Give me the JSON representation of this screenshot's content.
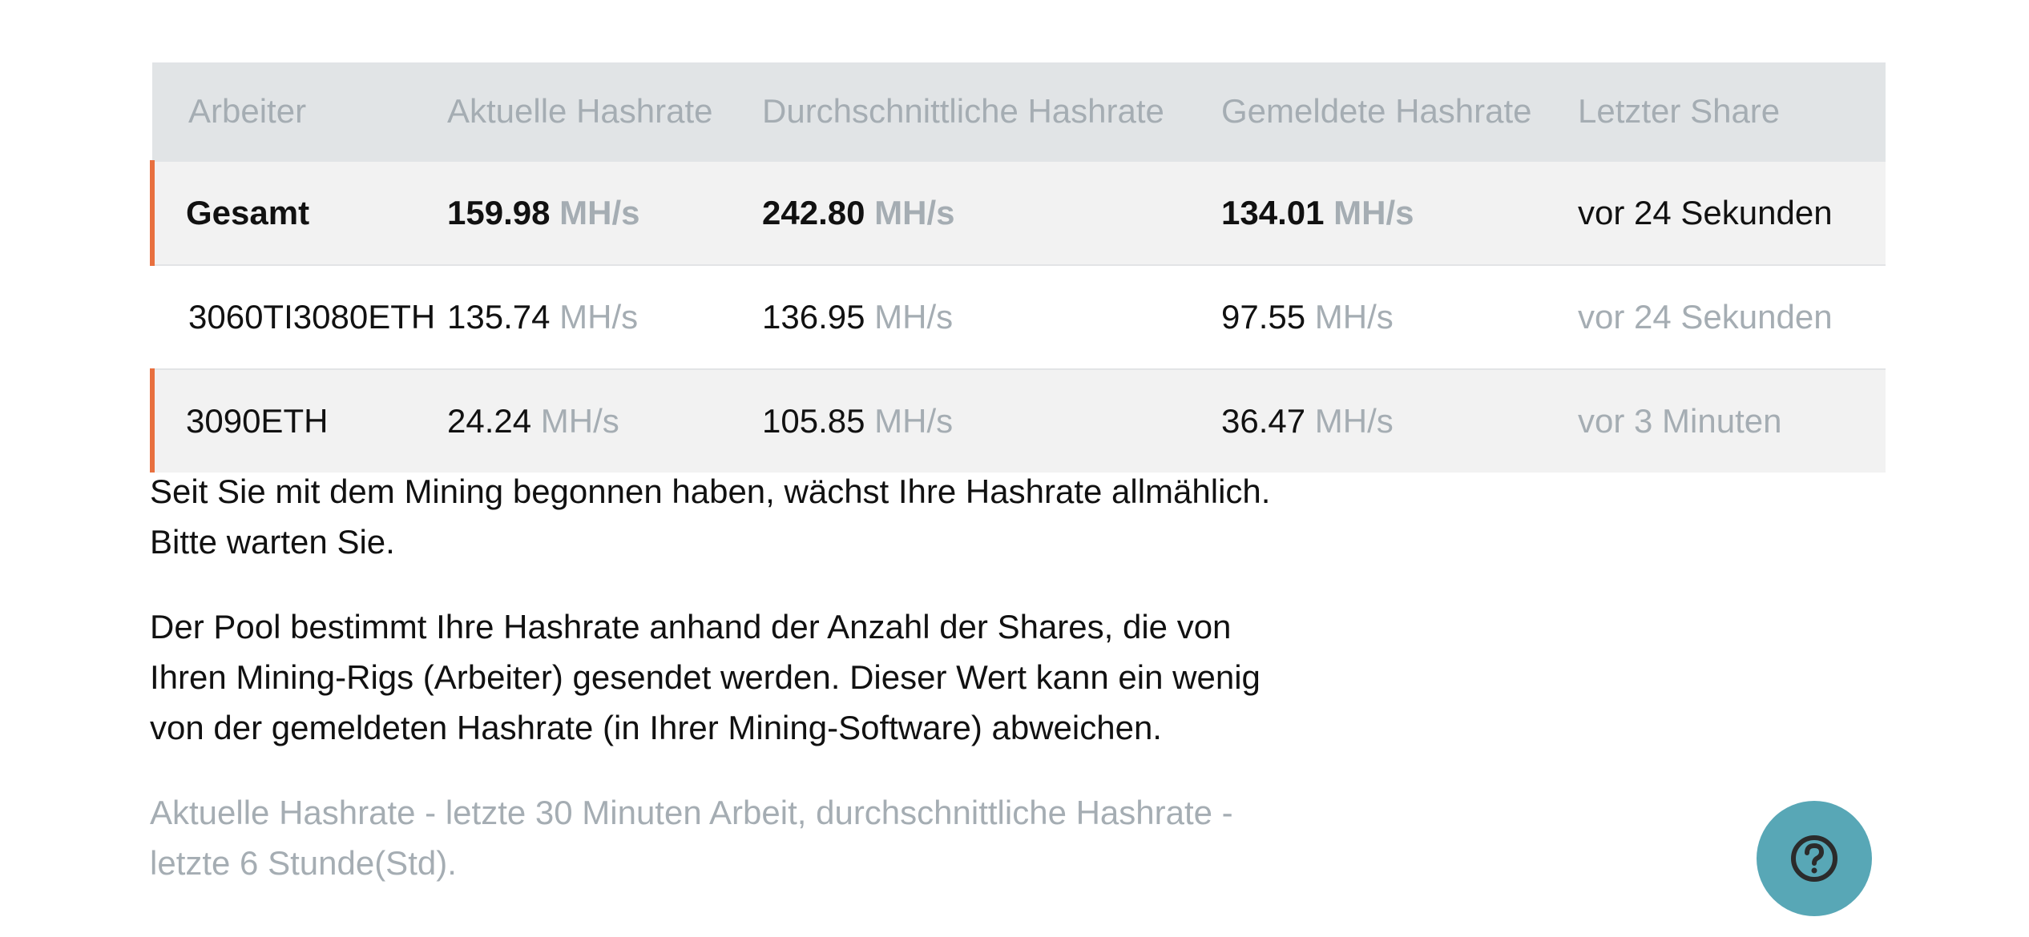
{
  "table": {
    "headers": [
      "Arbeiter",
      "Aktuelle Hashrate",
      "Durchschnittliche Hashrate",
      "Gemeldete Hashrate",
      "Letzter Share"
    ],
    "unit": "MH/s",
    "rows": [
      {
        "worker": "Gesamt",
        "current": "159.98",
        "average": "242.80",
        "reported": "134.01",
        "last_share": "vor 24 Sekunden"
      },
      {
        "worker": "3060TI3080ETH",
        "current": "135.74",
        "average": "136.95",
        "reported": "97.55",
        "last_share": "vor 24 Sekunden"
      },
      {
        "worker": "3090ETH",
        "current": "24.24",
        "average": "105.85",
        "reported": "36.47",
        "last_share": "vor 3 Minuten"
      }
    ]
  },
  "notes": {
    "growth": "Seit Sie mit dem Mining begonnen haben, wächst Ihre Hashrate allmählich. Bitte warten Sie.",
    "pool": "Der Pool bestimmt Ihre Hashrate anhand der Anzahl der Shares, die von Ihren Mining-Rigs (Arbeiter) gesendet werden. Dieser Wert kann ein wenig von der gemeldeten Hashrate (in Ihrer Mining-Software) abweichen.",
    "footnote": "Aktuelle Hashrate - letzte 30 Minuten Arbeit, durchschnittliche Hashrate - letzte 6 Stunde(Std)."
  },
  "colors": {
    "accent": "#e8703f",
    "help_button": "#58a7b6",
    "muted_text": "#a5adb3",
    "header_bg": "#e1e4e6"
  },
  "icons": {
    "help": "question-circle-icon"
  }
}
